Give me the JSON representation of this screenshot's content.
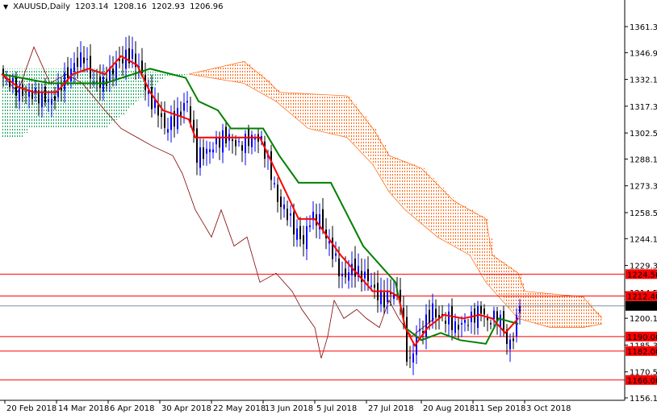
{
  "header": {
    "symbol": "XAUUSD,Daily",
    "open": "1203.14",
    "high": "1208.16",
    "low": "1202.93",
    "close": "1206.96"
  },
  "chart_data": {
    "type": "candlestick",
    "title": "XAUUSD,Daily",
    "ylim": [
      1150,
      1370
    ],
    "y_ticks": [
      "1361.30",
      "1346.90",
      "1332.10",
      "1317.30",
      "1302.50",
      "1288.10",
      "1273.30",
      "1258.50",
      "1244.10",
      "1229.30",
      "1214.50",
      "1200.10",
      "1185.30",
      "1170.50",
      "1156.10"
    ],
    "x_ticks": [
      {
        "bar": 1,
        "label": "20 Feb 2018"
      },
      {
        "bar": 17,
        "label": "14 Mar 2018"
      },
      {
        "bar": 33,
        "label": "6 Apr 2018"
      },
      {
        "bar": 49,
        "label": "30 Apr 2018"
      },
      {
        "bar": 65,
        "label": "22 May 2018"
      },
      {
        "bar": 81,
        "label": "13 Jun 2018"
      },
      {
        "bar": 97,
        "label": "5 Jul 2018"
      },
      {
        "bar": 113,
        "label": "27 Jul 2018"
      },
      {
        "bar": 130,
        "label": "20 Aug 2018"
      },
      {
        "bar": 146,
        "label": "11 Sep 2018"
      },
      {
        "bar": 162,
        "label": "3 Oct 2018"
      }
    ],
    "close_path": [
      [
        0,
        1335
      ],
      [
        5,
        1325
      ],
      [
        8,
        1325
      ],
      [
        15,
        1320
      ],
      [
        18,
        1330
      ],
      [
        22,
        1340
      ],
      [
        25,
        1345
      ],
      [
        28,
        1330
      ],
      [
        31,
        1330
      ],
      [
        35,
        1340
      ],
      [
        38,
        1345
      ],
      [
        40,
        1345
      ],
      [
        43,
        1335
      ],
      [
        45,
        1322
      ],
      [
        48,
        1315
      ],
      [
        50,
        1305
      ],
      [
        53,
        1310
      ],
      [
        55,
        1315
      ],
      [
        57,
        1320
      ],
      [
        59,
        1300
      ],
      [
        60,
        1290
      ],
      [
        63,
        1292
      ],
      [
        65,
        1295
      ],
      [
        68,
        1300
      ],
      [
        70,
        1300
      ],
      [
        73,
        1295
      ],
      [
        75,
        1298
      ],
      [
        78,
        1300
      ],
      [
        80,
        1298
      ],
      [
        83,
        1280
      ],
      [
        85,
        1265
      ],
      [
        88,
        1258
      ],
      [
        90,
        1250
      ],
      [
        93,
        1242
      ],
      [
        95,
        1255
      ],
      [
        98,
        1255
      ],
      [
        100,
        1245
      ],
      [
        103,
        1232
      ],
      [
        105,
        1222
      ],
      [
        108,
        1228
      ],
      [
        110,
        1225
      ],
      [
        113,
        1222
      ],
      [
        115,
        1215
      ],
      [
        118,
        1210
      ],
      [
        120,
        1215
      ],
      [
        123,
        1212
      ],
      [
        125,
        1180
      ],
      [
        126,
        1175
      ],
      [
        128,
        1190
      ],
      [
        130,
        1195
      ],
      [
        133,
        1205
      ],
      [
        135,
        1200
      ],
      [
        138,
        1200
      ],
      [
        140,
        1195
      ],
      [
        143,
        1198
      ],
      [
        145,
        1200
      ],
      [
        148,
        1205
      ],
      [
        150,
        1198
      ],
      [
        153,
        1202
      ],
      [
        155,
        1195
      ],
      [
        156,
        1185
      ],
      [
        158,
        1190
      ],
      [
        160,
        1206.96
      ]
    ],
    "tenkan_path": [
      [
        0,
        1335
      ],
      [
        5,
        1328
      ],
      [
        10,
        1325
      ],
      [
        17,
        1325
      ],
      [
        22,
        1335
      ],
      [
        27,
        1338
      ],
      [
        32,
        1335
      ],
      [
        37,
        1345
      ],
      [
        42,
        1340
      ],
      [
        46,
        1325
      ],
      [
        50,
        1315
      ],
      [
        55,
        1312
      ],
      [
        58,
        1310
      ],
      [
        60,
        1300
      ],
      [
        65,
        1300
      ],
      [
        72,
        1300
      ],
      [
        80,
        1300
      ],
      [
        84,
        1285
      ],
      [
        88,
        1270
      ],
      [
        92,
        1255
      ],
      [
        97,
        1255
      ],
      [
        101,
        1245
      ],
      [
        105,
        1235
      ],
      [
        110,
        1225
      ],
      [
        115,
        1215
      ],
      [
        120,
        1215
      ],
      [
        123,
        1212
      ],
      [
        125,
        1195
      ],
      [
        128,
        1185
      ],
      [
        132,
        1195
      ],
      [
        137,
        1202
      ],
      [
        143,
        1200
      ],
      [
        148,
        1202
      ],
      [
        152,
        1200
      ],
      [
        156,
        1192
      ],
      [
        160,
        1200
      ]
    ],
    "kijun_path": [
      [
        0,
        1335
      ],
      [
        15,
        1330
      ],
      [
        32,
        1330
      ],
      [
        46,
        1338
      ],
      [
        57,
        1333
      ],
      [
        61,
        1320
      ],
      [
        67,
        1315
      ],
      [
        71,
        1305
      ],
      [
        81,
        1305
      ],
      [
        86,
        1290
      ],
      [
        92,
        1275
      ],
      [
        102,
        1275
      ],
      [
        112,
        1240
      ],
      [
        122,
        1220
      ],
      [
        125,
        1195
      ],
      [
        130,
        1188
      ],
      [
        136,
        1192
      ],
      [
        142,
        1188
      ],
      [
        150,
        1186
      ],
      [
        154,
        1200
      ],
      [
        160,
        1197
      ]
    ],
    "senkou_upper_path": [
      [
        0,
        1338
      ],
      [
        32,
        1338
      ],
      [
        58,
        1335
      ],
      [
        75,
        1342
      ],
      [
        82,
        1332
      ],
      [
        86,
        1325
      ],
      [
        107,
        1323
      ],
      [
        115,
        1305
      ],
      [
        120,
        1290
      ],
      [
        130,
        1283
      ],
      [
        140,
        1265
      ],
      [
        150,
        1255
      ],
      [
        152,
        1235
      ],
      [
        160,
        1225
      ],
      [
        162,
        1215
      ],
      [
        180,
        1212
      ],
      [
        186,
        1200
      ]
    ],
    "senkou_lower_path": [
      [
        0,
        1300
      ],
      [
        6,
        1300
      ],
      [
        8,
        1305
      ],
      [
        32,
        1305
      ],
      [
        50,
        1333
      ],
      [
        58,
        1335
      ],
      [
        75,
        1330
      ],
      [
        85,
        1320
      ],
      [
        95,
        1305
      ],
      [
        107,
        1300
      ],
      [
        115,
        1285
      ],
      [
        120,
        1270
      ],
      [
        125,
        1260
      ],
      [
        135,
        1245
      ],
      [
        145,
        1235
      ],
      [
        150,
        1220
      ],
      [
        160,
        1200
      ],
      [
        170,
        1195
      ],
      [
        180,
        1195
      ],
      [
        186,
        1197
      ]
    ],
    "cloud_bullish_until_bar": 58,
    "chikou_path": [
      [
        0,
        1335
      ],
      [
        5,
        1325
      ],
      [
        10,
        1350
      ],
      [
        15,
        1330
      ],
      [
        20,
        1335
      ],
      [
        25,
        1330
      ],
      [
        32,
        1315
      ],
      [
        37,
        1305
      ],
      [
        42,
        1300
      ],
      [
        47,
        1295
      ],
      [
        53,
        1290
      ],
      [
        56,
        1280
      ],
      [
        60,
        1260
      ],
      [
        65,
        1245
      ],
      [
        68,
        1260
      ],
      [
        72,
        1240
      ],
      [
        76,
        1245
      ],
      [
        80,
        1220
      ],
      [
        85,
        1225
      ],
      [
        90,
        1215
      ],
      [
        93,
        1205
      ],
      [
        95,
        1200
      ],
      [
        97,
        1195
      ],
      [
        99,
        1178
      ],
      [
        101,
        1190
      ],
      [
        103,
        1210
      ],
      [
        106,
        1200
      ],
      [
        110,
        1205
      ],
      [
        113,
        1200
      ],
      [
        117,
        1195
      ],
      [
        120,
        1210
      ],
      [
        123,
        1200
      ],
      [
        127,
        1190
      ],
      [
        134,
        1200
      ]
    ],
    "levels": [
      {
        "price": 1224.5,
        "label": "1224.50"
      },
      {
        "price": 1212.4,
        "label": "1212.40"
      },
      {
        "price": 1190.0,
        "label": "1190.00"
      },
      {
        "price": 1182.0,
        "label": "1182.00"
      },
      {
        "price": 1166.0,
        "label": "1166.00"
      }
    ],
    "current_price": {
      "price": 1206.96,
      "label": "1206.96"
    },
    "colors": {
      "bull": "#0000ff",
      "bear": "#000000",
      "tenkan": "#ff0000",
      "kijun": "#008000",
      "chikou": "#800000",
      "cloud_up": "#00a050",
      "cloud_down": "#ff6000",
      "level": "#ff0000"
    }
  }
}
